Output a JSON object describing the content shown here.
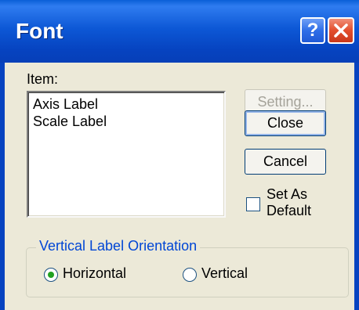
{
  "window": {
    "title": "Font",
    "help_glyph": "?",
    "close_icon": "close-icon"
  },
  "item_list": {
    "label": "Item:",
    "items": [
      "Axis Label",
      "Scale Label"
    ]
  },
  "buttons": {
    "setting": "Setting...",
    "close": "Close",
    "cancel": "Cancel"
  },
  "set_as_default": {
    "line1": "Set As",
    "line2": "Default",
    "checked": false
  },
  "orientation": {
    "group_title": "Vertical Label Orientation",
    "options": [
      "Horizontal",
      "Vertical"
    ],
    "selected": "Horizontal"
  },
  "colors": {
    "titlebar": "#0643c0",
    "face": "#ece9d8",
    "group_title": "#0046d5",
    "radio_dot": "#21a121"
  }
}
